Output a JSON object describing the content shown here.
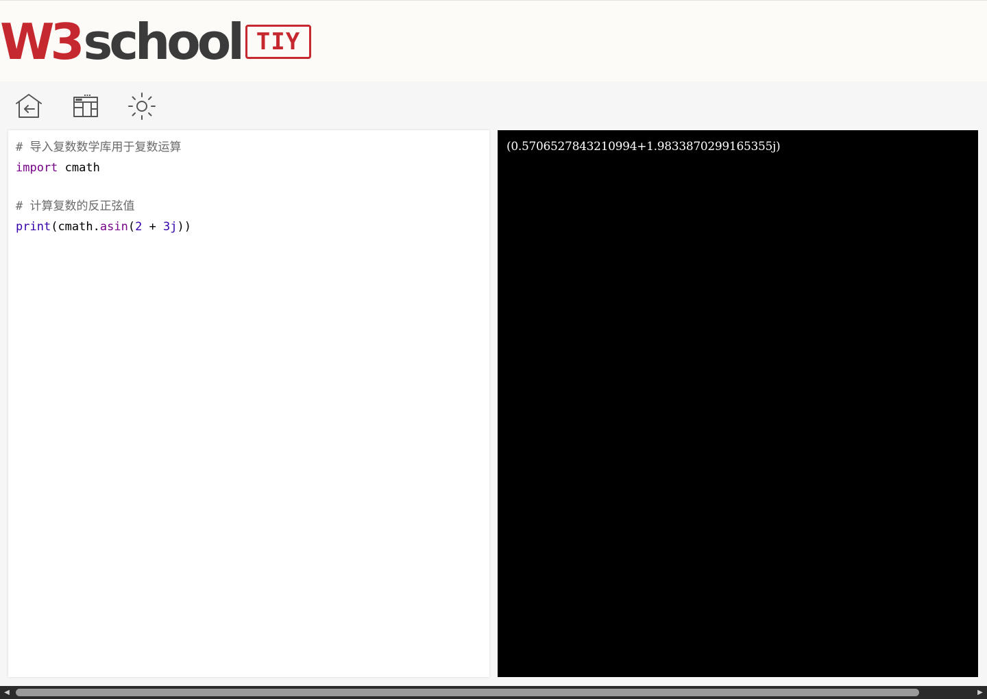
{
  "header": {
    "logo_w3": "W3",
    "logo_school": "school",
    "badge": "TIY",
    "colors": {
      "brand_red": "#c5282f",
      "logo_dark": "#3b3b3b",
      "header_bg": "#fcfbf8"
    }
  },
  "toolbar": {
    "buttons": [
      {
        "name": "home-back-icon"
      },
      {
        "name": "layout-toggle-icon"
      },
      {
        "name": "theme-brightness-icon"
      }
    ]
  },
  "editor": {
    "lines": [
      {
        "kind": "comment",
        "text": "# 导入复数数学库用于复数运算"
      },
      {
        "kind": "code",
        "tokens": {
          "keyword": "import",
          "space": " ",
          "module": "cmath"
        }
      },
      {
        "kind": "blank"
      },
      {
        "kind": "comment",
        "text": "# 计算复数的反正弦值"
      },
      {
        "kind": "code",
        "tokens": {
          "fn": "print",
          "open": "(",
          "obj": "cmath",
          "dot": ".",
          "method": "asin",
          "open2": "(",
          "num1": "2",
          "plus": " + ",
          "num2": "3j",
          "close": "))"
        }
      }
    ]
  },
  "output": {
    "text": "(0.5706527843210994+1.9833870299165355j)",
    "colors": {
      "bg": "#000000",
      "fg": "#ffffff"
    }
  },
  "scrollbar": {
    "left_arrow": "◀",
    "right_arrow": "▶"
  }
}
